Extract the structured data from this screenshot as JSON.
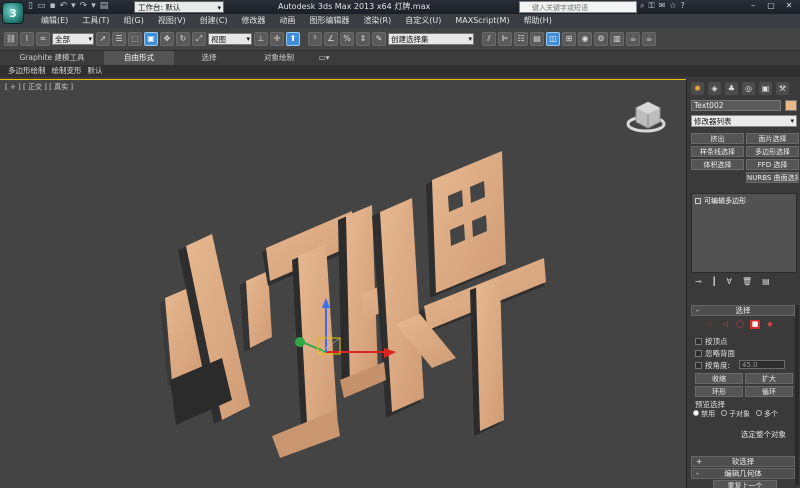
{
  "titlebar": {
    "workspace": "工作台: 默认",
    "app_title": "Autodesk 3ds Max  2013 x64      灯牌.max",
    "search_placeholder": "键入关键字或短语"
  },
  "menu": [
    "编辑(E)",
    "工具(T)",
    "组(G)",
    "视图(V)",
    "创建(C)",
    "修改器",
    "动画",
    "图形编辑器",
    "渲染(R)",
    "自定义(U)",
    "MAXScript(M)",
    "帮助(H)"
  ],
  "toolbar": {
    "filter_select": "全部",
    "view_select": "视图",
    "named_selection": "创建选择集"
  },
  "ribbon": {
    "tabs": [
      "Graphite 建模工具",
      "自由形式",
      "选择",
      "对象绘制"
    ],
    "sub_items": [
      "多边形绘制",
      "绘制变形",
      "默认"
    ]
  },
  "viewport": {
    "label": "[ + ] [ 正交 ] [ 真实 ]",
    "text_3d": "灯牌",
    "object_color": "#e0ad85"
  },
  "command_panel": {
    "object_name": "Text002",
    "modifier_list": "修改器列表",
    "modifier_buttons": [
      "挤出",
      "面片选择",
      "样条线选择",
      "多边形选择",
      "体积选择",
      "FFD 选择",
      "",
      "NURBS 曲面选择"
    ],
    "stack_item": "可编辑多边形",
    "selection_rollout": "选择",
    "options": [
      "按顶点",
      "忽略背面",
      "按角度:"
    ],
    "angle_value": "45.0",
    "shrink": "收缩",
    "grow": "扩大",
    "ring": "环形",
    "loop": "循环",
    "preview_label": "预览选择",
    "radio_disabled": "禁用",
    "radio_subobj": "子对象",
    "radio_multi": "多个",
    "select_all": "选定整个对象",
    "soft_selection": "软选择",
    "edit_geometry": "编辑几何体",
    "repeat_last": "重复上一个"
  }
}
